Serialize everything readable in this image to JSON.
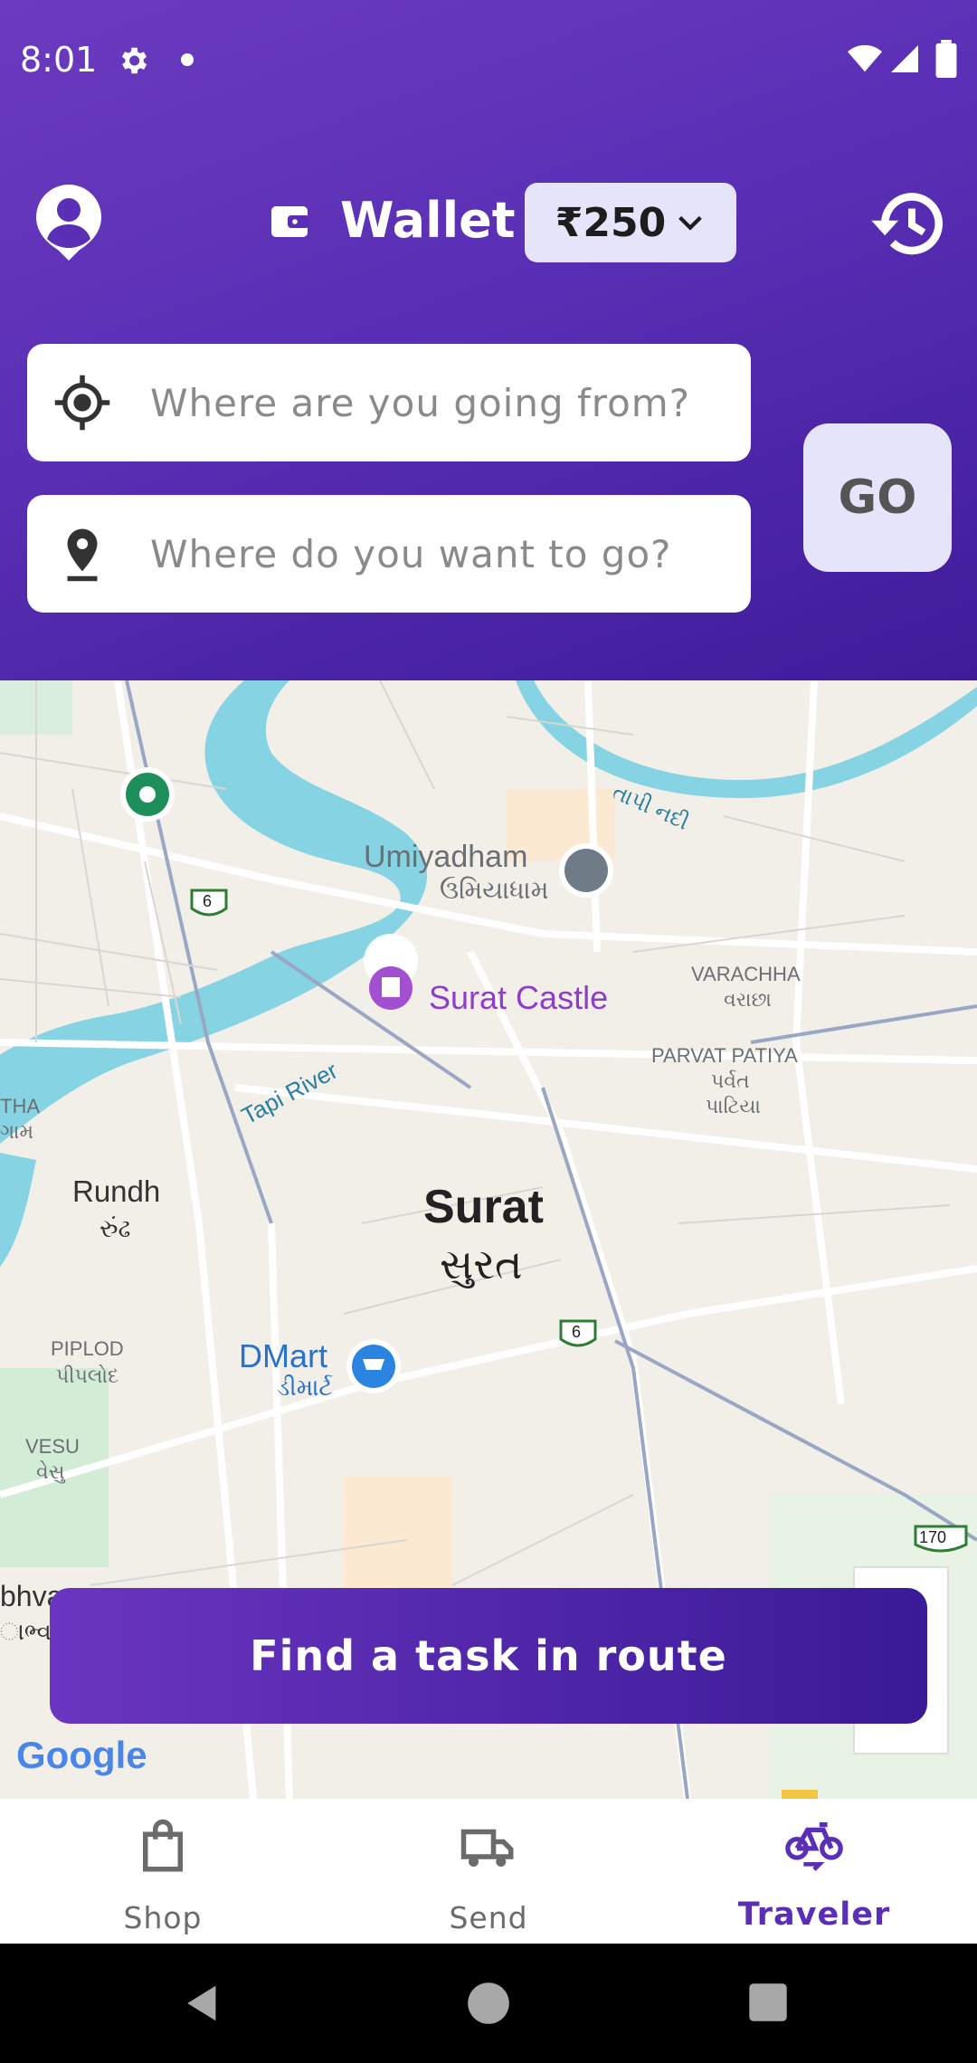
{
  "status_bar": {
    "time": "8:01"
  },
  "header": {
    "wallet_title": "Wallet",
    "balance": "₹250",
    "from_placeholder": "Where are you going from?",
    "to_placeholder": "Where do you want to go?",
    "go_label": "GO"
  },
  "map": {
    "labels": {
      "umiyadham": "Umiyadham",
      "umiyadham_gu": "ઉમિયાધામ",
      "surat_castle": "Surat Castle",
      "varachha": "VARACHHA",
      "varachha_gu": "વરાછા",
      "parvat_patiya": "PARVAT PATIYA",
      "parvat_gu1": "પર્વત",
      "parvat_gu2": "પાટિયા",
      "tha": "THA",
      "gam": "ગામ",
      "tapi_river": "Tapi River",
      "tapi_nadi": "તાપી નદી",
      "rundh": "Rundh",
      "rundh_gu": "રુંઢ",
      "surat": "Surat",
      "surat_gu": "સુરત",
      "piplod": "PIPLOD",
      "piplod_gu": "પીપલોદ",
      "dmart": "DMart",
      "dmart_gu": "ડીમાર્ટ",
      "vesu": "VESU",
      "vesu_gu": "વેસુ",
      "bhva": "bhva",
      "bhva_gu": "ાભ્વ",
      "hw6a": "6",
      "hw6b": "6",
      "hw170": "170"
    },
    "find_button": "Find a task in route",
    "google": "Google"
  },
  "bottom_nav": {
    "shop": "Shop",
    "send": "Send",
    "traveler": "Traveler",
    "active": "traveler"
  },
  "colors": {
    "brand": "#5a2fb5",
    "active_nav": "#5a2fb5",
    "inactive_nav": "#6b6b6b",
    "river": "#86d3e3",
    "park": "#c8ebd0"
  }
}
